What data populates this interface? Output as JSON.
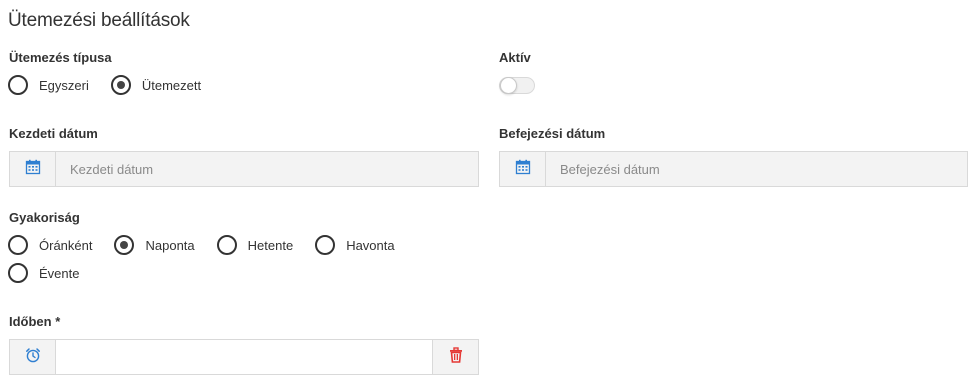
{
  "page": {
    "title": "Ütemezési beállítások"
  },
  "schedule_type": {
    "label": "Ütemezés típusa",
    "options": [
      {
        "label": "Egyszeri",
        "checked": false
      },
      {
        "label": "Ütemezett",
        "checked": true
      }
    ]
  },
  "active": {
    "label": "Aktív",
    "on": false
  },
  "start_date": {
    "label": "Kezdeti dátum",
    "placeholder": "Kezdeti dátum",
    "value": ""
  },
  "end_date": {
    "label": "Befejezési dátum",
    "placeholder": "Befejezési dátum",
    "value": ""
  },
  "frequency": {
    "label": "Gyakoriság",
    "options": [
      {
        "label": "Óránként",
        "checked": false
      },
      {
        "label": "Naponta",
        "checked": true
      },
      {
        "label": "Hetente",
        "checked": false
      },
      {
        "label": "Havonta",
        "checked": false
      },
      {
        "label": "Évente",
        "checked": false
      }
    ]
  },
  "time": {
    "label": "Időben *",
    "value": ""
  },
  "icons": {
    "date": "calendar-icon",
    "time": "alarm-clock-icon",
    "delete": "trash-icon"
  },
  "colors": {
    "icon_blue": "#2f7fd1",
    "delete_red": "#e53935"
  }
}
